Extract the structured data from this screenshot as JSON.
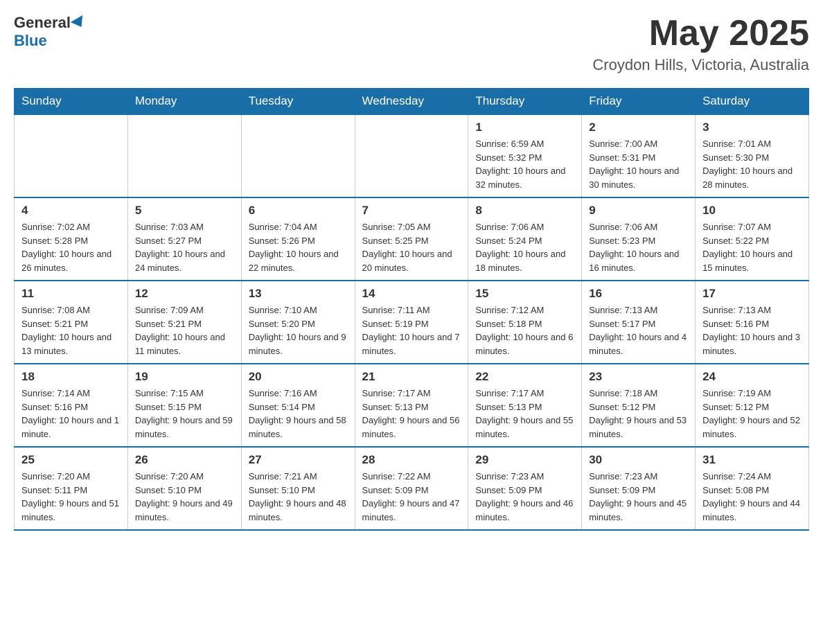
{
  "header": {
    "logo_general": "General",
    "logo_blue": "Blue",
    "month_title": "May 2025",
    "location": "Croydon Hills, Victoria, Australia"
  },
  "weekdays": [
    "Sunday",
    "Monday",
    "Tuesday",
    "Wednesday",
    "Thursday",
    "Friday",
    "Saturday"
  ],
  "weeks": [
    [
      {
        "day": "",
        "info": ""
      },
      {
        "day": "",
        "info": ""
      },
      {
        "day": "",
        "info": ""
      },
      {
        "day": "",
        "info": ""
      },
      {
        "day": "1",
        "info": "Sunrise: 6:59 AM\nSunset: 5:32 PM\nDaylight: 10 hours and 32 minutes."
      },
      {
        "day": "2",
        "info": "Sunrise: 7:00 AM\nSunset: 5:31 PM\nDaylight: 10 hours and 30 minutes."
      },
      {
        "day": "3",
        "info": "Sunrise: 7:01 AM\nSunset: 5:30 PM\nDaylight: 10 hours and 28 minutes."
      }
    ],
    [
      {
        "day": "4",
        "info": "Sunrise: 7:02 AM\nSunset: 5:28 PM\nDaylight: 10 hours and 26 minutes."
      },
      {
        "day": "5",
        "info": "Sunrise: 7:03 AM\nSunset: 5:27 PM\nDaylight: 10 hours and 24 minutes."
      },
      {
        "day": "6",
        "info": "Sunrise: 7:04 AM\nSunset: 5:26 PM\nDaylight: 10 hours and 22 minutes."
      },
      {
        "day": "7",
        "info": "Sunrise: 7:05 AM\nSunset: 5:25 PM\nDaylight: 10 hours and 20 minutes."
      },
      {
        "day": "8",
        "info": "Sunrise: 7:06 AM\nSunset: 5:24 PM\nDaylight: 10 hours and 18 minutes."
      },
      {
        "day": "9",
        "info": "Sunrise: 7:06 AM\nSunset: 5:23 PM\nDaylight: 10 hours and 16 minutes."
      },
      {
        "day": "10",
        "info": "Sunrise: 7:07 AM\nSunset: 5:22 PM\nDaylight: 10 hours and 15 minutes."
      }
    ],
    [
      {
        "day": "11",
        "info": "Sunrise: 7:08 AM\nSunset: 5:21 PM\nDaylight: 10 hours and 13 minutes."
      },
      {
        "day": "12",
        "info": "Sunrise: 7:09 AM\nSunset: 5:21 PM\nDaylight: 10 hours and 11 minutes."
      },
      {
        "day": "13",
        "info": "Sunrise: 7:10 AM\nSunset: 5:20 PM\nDaylight: 10 hours and 9 minutes."
      },
      {
        "day": "14",
        "info": "Sunrise: 7:11 AM\nSunset: 5:19 PM\nDaylight: 10 hours and 7 minutes."
      },
      {
        "day": "15",
        "info": "Sunrise: 7:12 AM\nSunset: 5:18 PM\nDaylight: 10 hours and 6 minutes."
      },
      {
        "day": "16",
        "info": "Sunrise: 7:13 AM\nSunset: 5:17 PM\nDaylight: 10 hours and 4 minutes."
      },
      {
        "day": "17",
        "info": "Sunrise: 7:13 AM\nSunset: 5:16 PM\nDaylight: 10 hours and 3 minutes."
      }
    ],
    [
      {
        "day": "18",
        "info": "Sunrise: 7:14 AM\nSunset: 5:16 PM\nDaylight: 10 hours and 1 minute."
      },
      {
        "day": "19",
        "info": "Sunrise: 7:15 AM\nSunset: 5:15 PM\nDaylight: 9 hours and 59 minutes."
      },
      {
        "day": "20",
        "info": "Sunrise: 7:16 AM\nSunset: 5:14 PM\nDaylight: 9 hours and 58 minutes."
      },
      {
        "day": "21",
        "info": "Sunrise: 7:17 AM\nSunset: 5:13 PM\nDaylight: 9 hours and 56 minutes."
      },
      {
        "day": "22",
        "info": "Sunrise: 7:17 AM\nSunset: 5:13 PM\nDaylight: 9 hours and 55 minutes."
      },
      {
        "day": "23",
        "info": "Sunrise: 7:18 AM\nSunset: 5:12 PM\nDaylight: 9 hours and 53 minutes."
      },
      {
        "day": "24",
        "info": "Sunrise: 7:19 AM\nSunset: 5:12 PM\nDaylight: 9 hours and 52 minutes."
      }
    ],
    [
      {
        "day": "25",
        "info": "Sunrise: 7:20 AM\nSunset: 5:11 PM\nDaylight: 9 hours and 51 minutes."
      },
      {
        "day": "26",
        "info": "Sunrise: 7:20 AM\nSunset: 5:10 PM\nDaylight: 9 hours and 49 minutes."
      },
      {
        "day": "27",
        "info": "Sunrise: 7:21 AM\nSunset: 5:10 PM\nDaylight: 9 hours and 48 minutes."
      },
      {
        "day": "28",
        "info": "Sunrise: 7:22 AM\nSunset: 5:09 PM\nDaylight: 9 hours and 47 minutes."
      },
      {
        "day": "29",
        "info": "Sunrise: 7:23 AM\nSunset: 5:09 PM\nDaylight: 9 hours and 46 minutes."
      },
      {
        "day": "30",
        "info": "Sunrise: 7:23 AM\nSunset: 5:09 PM\nDaylight: 9 hours and 45 minutes."
      },
      {
        "day": "31",
        "info": "Sunrise: 7:24 AM\nSunset: 5:08 PM\nDaylight: 9 hours and 44 minutes."
      }
    ]
  ]
}
